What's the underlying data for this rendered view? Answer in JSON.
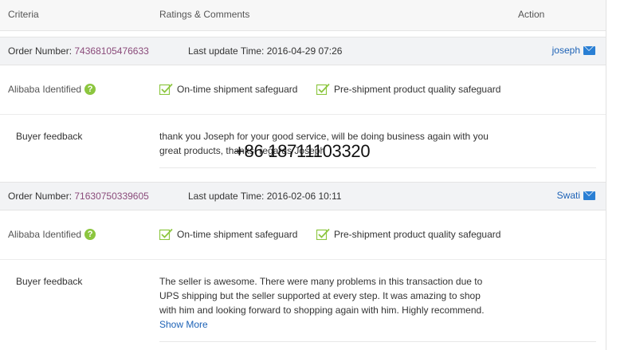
{
  "header": {
    "criteria": "Criteria",
    "ratings": "Ratings & Comments",
    "action": "Action"
  },
  "orders": [
    {
      "order_label": "Order Number:",
      "order_number": "74368105476633",
      "update_label": "Last update Time:",
      "update_time": "2016-04-29 07:26",
      "buyer": "joseph",
      "identified_label": "Alibaba Identified",
      "safeguard_1": "On-time shipment safeguard",
      "safeguard_2": "Pre-shipment product quality safeguard",
      "feedback_label": "Buyer feedback",
      "feedback_line_1": "thank you Joseph for your good service, will be doing business again with you",
      "feedback_line_2": "great products, thanks. regards Joseph"
    },
    {
      "order_label": "Order Number:",
      "order_number": "71630750339605",
      "update_label": "Last update Time:",
      "update_time": "2016-02-06 10:11",
      "buyer": "Swati",
      "identified_label": "Alibaba Identified",
      "safeguard_1": "On-time shipment safeguard",
      "safeguard_2": "Pre-shipment product quality safeguard",
      "feedback_label": "Buyer feedback",
      "feedback_line_1": "The seller is awesome. There were many problems in this transaction due to",
      "feedback_line_2": "UPS shipping but the seller supported at every step. It was amazing to shop",
      "feedback_line_3": "with him and looking forward to shopping again with him. Highly recommend.",
      "show_more": "Show More"
    }
  ],
  "overlay_phone": "+86 18711103320",
  "icons": {
    "contact": "mail-icon",
    "identified": "question-icon",
    "safeguard": "check-icon"
  },
  "colors": {
    "order_number": "#8a4a7a",
    "link": "#1d62b6",
    "check": "#8cc63f"
  }
}
